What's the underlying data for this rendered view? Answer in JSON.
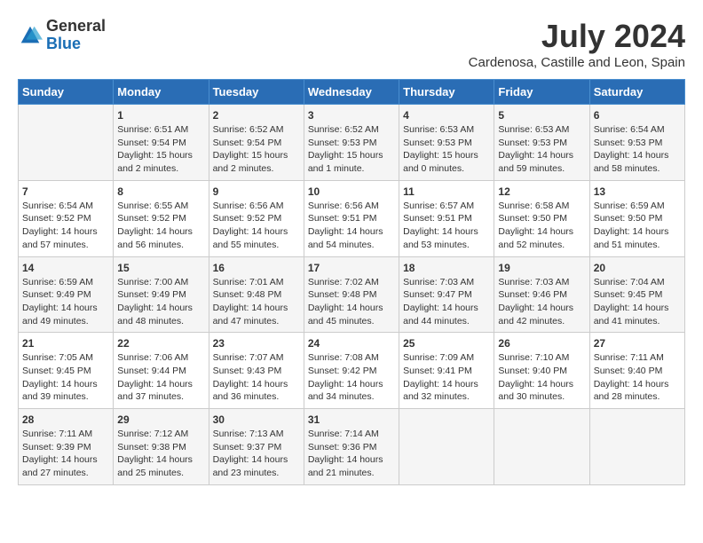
{
  "header": {
    "logo_general": "General",
    "logo_blue": "Blue",
    "month_year": "July 2024",
    "location": "Cardenosa, Castille and Leon, Spain"
  },
  "days_of_week": [
    "Sunday",
    "Monday",
    "Tuesday",
    "Wednesday",
    "Thursday",
    "Friday",
    "Saturday"
  ],
  "weeks": [
    [
      {
        "day": "",
        "sunrise": "",
        "sunset": "",
        "daylight": ""
      },
      {
        "day": "1",
        "sunrise": "Sunrise: 6:51 AM",
        "sunset": "Sunset: 9:54 PM",
        "daylight": "Daylight: 15 hours and 2 minutes."
      },
      {
        "day": "2",
        "sunrise": "Sunrise: 6:52 AM",
        "sunset": "Sunset: 9:54 PM",
        "daylight": "Daylight: 15 hours and 2 minutes."
      },
      {
        "day": "3",
        "sunrise": "Sunrise: 6:52 AM",
        "sunset": "Sunset: 9:53 PM",
        "daylight": "Daylight: 15 hours and 1 minute."
      },
      {
        "day": "4",
        "sunrise": "Sunrise: 6:53 AM",
        "sunset": "Sunset: 9:53 PM",
        "daylight": "Daylight: 15 hours and 0 minutes."
      },
      {
        "day": "5",
        "sunrise": "Sunrise: 6:53 AM",
        "sunset": "Sunset: 9:53 PM",
        "daylight": "Daylight: 14 hours and 59 minutes."
      },
      {
        "day": "6",
        "sunrise": "Sunrise: 6:54 AM",
        "sunset": "Sunset: 9:53 PM",
        "daylight": "Daylight: 14 hours and 58 minutes."
      }
    ],
    [
      {
        "day": "7",
        "sunrise": "Sunrise: 6:54 AM",
        "sunset": "Sunset: 9:52 PM",
        "daylight": "Daylight: 14 hours and 57 minutes."
      },
      {
        "day": "8",
        "sunrise": "Sunrise: 6:55 AM",
        "sunset": "Sunset: 9:52 PM",
        "daylight": "Daylight: 14 hours and 56 minutes."
      },
      {
        "day": "9",
        "sunrise": "Sunrise: 6:56 AM",
        "sunset": "Sunset: 9:52 PM",
        "daylight": "Daylight: 14 hours and 55 minutes."
      },
      {
        "day": "10",
        "sunrise": "Sunrise: 6:56 AM",
        "sunset": "Sunset: 9:51 PM",
        "daylight": "Daylight: 14 hours and 54 minutes."
      },
      {
        "day": "11",
        "sunrise": "Sunrise: 6:57 AM",
        "sunset": "Sunset: 9:51 PM",
        "daylight": "Daylight: 14 hours and 53 minutes."
      },
      {
        "day": "12",
        "sunrise": "Sunrise: 6:58 AM",
        "sunset": "Sunset: 9:50 PM",
        "daylight": "Daylight: 14 hours and 52 minutes."
      },
      {
        "day": "13",
        "sunrise": "Sunrise: 6:59 AM",
        "sunset": "Sunset: 9:50 PM",
        "daylight": "Daylight: 14 hours and 51 minutes."
      }
    ],
    [
      {
        "day": "14",
        "sunrise": "Sunrise: 6:59 AM",
        "sunset": "Sunset: 9:49 PM",
        "daylight": "Daylight: 14 hours and 49 minutes."
      },
      {
        "day": "15",
        "sunrise": "Sunrise: 7:00 AM",
        "sunset": "Sunset: 9:49 PM",
        "daylight": "Daylight: 14 hours and 48 minutes."
      },
      {
        "day": "16",
        "sunrise": "Sunrise: 7:01 AM",
        "sunset": "Sunset: 9:48 PM",
        "daylight": "Daylight: 14 hours and 47 minutes."
      },
      {
        "day": "17",
        "sunrise": "Sunrise: 7:02 AM",
        "sunset": "Sunset: 9:48 PM",
        "daylight": "Daylight: 14 hours and 45 minutes."
      },
      {
        "day": "18",
        "sunrise": "Sunrise: 7:03 AM",
        "sunset": "Sunset: 9:47 PM",
        "daylight": "Daylight: 14 hours and 44 minutes."
      },
      {
        "day": "19",
        "sunrise": "Sunrise: 7:03 AM",
        "sunset": "Sunset: 9:46 PM",
        "daylight": "Daylight: 14 hours and 42 minutes."
      },
      {
        "day": "20",
        "sunrise": "Sunrise: 7:04 AM",
        "sunset": "Sunset: 9:45 PM",
        "daylight": "Daylight: 14 hours and 41 minutes."
      }
    ],
    [
      {
        "day": "21",
        "sunrise": "Sunrise: 7:05 AM",
        "sunset": "Sunset: 9:45 PM",
        "daylight": "Daylight: 14 hours and 39 minutes."
      },
      {
        "day": "22",
        "sunrise": "Sunrise: 7:06 AM",
        "sunset": "Sunset: 9:44 PM",
        "daylight": "Daylight: 14 hours and 37 minutes."
      },
      {
        "day": "23",
        "sunrise": "Sunrise: 7:07 AM",
        "sunset": "Sunset: 9:43 PM",
        "daylight": "Daylight: 14 hours and 36 minutes."
      },
      {
        "day": "24",
        "sunrise": "Sunrise: 7:08 AM",
        "sunset": "Sunset: 9:42 PM",
        "daylight": "Daylight: 14 hours and 34 minutes."
      },
      {
        "day": "25",
        "sunrise": "Sunrise: 7:09 AM",
        "sunset": "Sunset: 9:41 PM",
        "daylight": "Daylight: 14 hours and 32 minutes."
      },
      {
        "day": "26",
        "sunrise": "Sunrise: 7:10 AM",
        "sunset": "Sunset: 9:40 PM",
        "daylight": "Daylight: 14 hours and 30 minutes."
      },
      {
        "day": "27",
        "sunrise": "Sunrise: 7:11 AM",
        "sunset": "Sunset: 9:40 PM",
        "daylight": "Daylight: 14 hours and 28 minutes."
      }
    ],
    [
      {
        "day": "28",
        "sunrise": "Sunrise: 7:11 AM",
        "sunset": "Sunset: 9:39 PM",
        "daylight": "Daylight: 14 hours and 27 minutes."
      },
      {
        "day": "29",
        "sunrise": "Sunrise: 7:12 AM",
        "sunset": "Sunset: 9:38 PM",
        "daylight": "Daylight: 14 hours and 25 minutes."
      },
      {
        "day": "30",
        "sunrise": "Sunrise: 7:13 AM",
        "sunset": "Sunset: 9:37 PM",
        "daylight": "Daylight: 14 hours and 23 minutes."
      },
      {
        "day": "31",
        "sunrise": "Sunrise: 7:14 AM",
        "sunset": "Sunset: 9:36 PM",
        "daylight": "Daylight: 14 hours and 21 minutes."
      },
      {
        "day": "",
        "sunrise": "",
        "sunset": "",
        "daylight": ""
      },
      {
        "day": "",
        "sunrise": "",
        "sunset": "",
        "daylight": ""
      },
      {
        "day": "",
        "sunrise": "",
        "sunset": "",
        "daylight": ""
      }
    ]
  ]
}
